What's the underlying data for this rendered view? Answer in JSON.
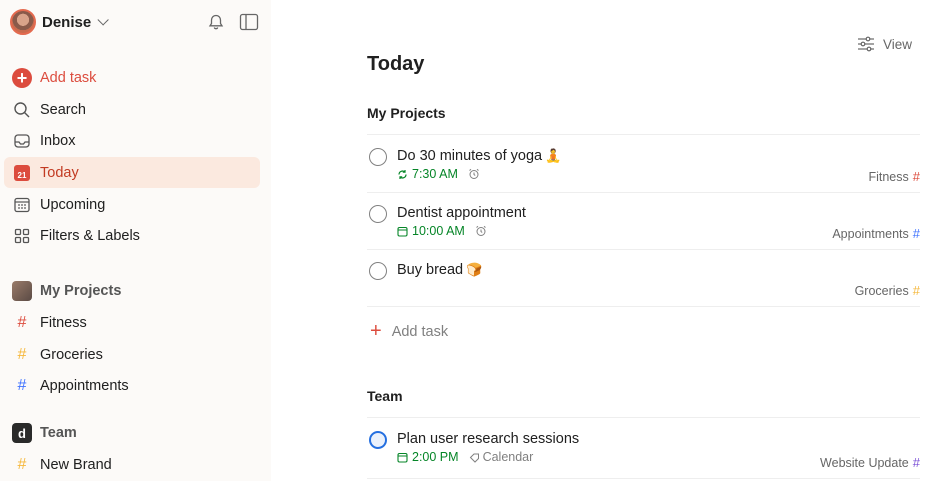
{
  "user": {
    "name": "Denise"
  },
  "sidebar": {
    "add_task": "Add task",
    "nav": [
      {
        "label": "Search",
        "icon": "search-icon"
      },
      {
        "label": "Inbox",
        "icon": "inbox-icon"
      },
      {
        "label": "Today",
        "icon": "today-calendar-icon",
        "day": "21"
      },
      {
        "label": "Upcoming",
        "icon": "calendar-grid-icon"
      },
      {
        "label": "Filters & Labels",
        "icon": "filters-grid-icon"
      }
    ],
    "my_projects": {
      "title": "My Projects",
      "items": [
        {
          "label": "Fitness",
          "color": "#dc4c3e"
        },
        {
          "label": "Groceries",
          "color": "#f5b83d"
        },
        {
          "label": "Appointments",
          "color": "#4073ff"
        }
      ]
    },
    "team": {
      "title": "Team",
      "badge": "d",
      "items": [
        {
          "label": "New Brand",
          "color": "#f5b83d"
        }
      ]
    }
  },
  "main": {
    "view_label": "View",
    "title": "Today",
    "groups": [
      {
        "title": "My Projects",
        "tasks": [
          {
            "title": "Do 30 minutes of yoga",
            "emoji": "🧘",
            "time": "7:30 AM",
            "alarm": true,
            "project": "Fitness",
            "project_color": "#dc4c3e",
            "recurring": true
          },
          {
            "title": "Dentist appointment",
            "time": "10:00 AM",
            "alarm": true,
            "project": "Appointments",
            "project_color": "#4073ff"
          },
          {
            "title": "Buy bread",
            "emoji": "🍞",
            "project": "Groceries",
            "project_color": "#f5b83d"
          }
        ],
        "add_task": "Add task"
      },
      {
        "title": "Team",
        "tasks": [
          {
            "title": "Plan user research sessions",
            "time": "2:00 PM",
            "label": "Calendar",
            "project": "Website Update",
            "project_color": "#7a4fd6"
          }
        ]
      }
    ]
  },
  "colors": {
    "accent": "#dc4c3e",
    "today_bg": "#fbe9df",
    "sidebar_bg": "#fcfaf8",
    "date_green": "#058527"
  }
}
